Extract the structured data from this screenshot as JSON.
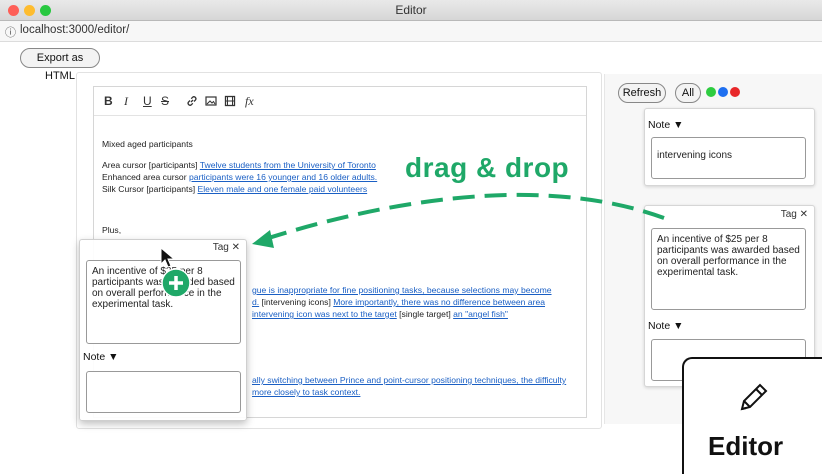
{
  "window": {
    "title": "Editor"
  },
  "address_bar": {
    "info_icon": "info-icon",
    "url": "localhost:3000/editor/"
  },
  "top_toolbar": {
    "export_label": "Export as HTML"
  },
  "editor": {
    "toolbar": {
      "bold": "B",
      "italic": "I",
      "underline": "U",
      "strike": "S",
      "icons": [
        "link-icon",
        "image-icon",
        "video-icon",
        "formula-icon"
      ],
      "formula": "fx"
    },
    "lines": {
      "l1": "Mixed aged participants",
      "l2_prefix": "Area cursor [participants]",
      "l2_link": "Twelve students from the University of Toronto",
      "l3_prefix": "Enhanced area cursor",
      "l3_link": "participants were 16 younger and 16 older adults.",
      "l4_prefix": "Silk Cursor [participants]",
      "l4_link": "Eleven male and one female paid volunteers",
      "l5": "Plus,",
      "l6_link": "gue is inappropriate for fine positioning tasks, because selections may become",
      "l7_link_a": "d.",
      "l7_mid": "[intervening icons]",
      "l7_link_b": "More importantly, there was no difference between area",
      "l8_link_a": "intervening icon was next to the target",
      "l8_mid": "[single target]",
      "l8_link_b": "an \"angel fish\"",
      "l9_link": "ally switching between Prince and point-cursor positioning techniques, the difficulty",
      "l10_link": "more closely to task context."
    }
  },
  "side_panel": {
    "refresh_label": "Refresh",
    "all_label": "All",
    "filter_colors": [
      "#2ecc40",
      "#1e6ff0",
      "#e8282a"
    ],
    "card1": {
      "note_label": "Note ▼",
      "note_text": "intervening icons"
    },
    "card2": {
      "tag_label": "Tag ✕",
      "text": "An incentive of $25 per 8 participants was awarded based on overall performance in the experimental task.",
      "note_label": "Note ▼"
    }
  },
  "dragged_card": {
    "tag_label": "Tag ✕",
    "text": "An incentive of $25 per 8 participants was awarded based on overall performance in the experimental task.",
    "note_label": "Note ▼"
  },
  "annotation": {
    "drag_text": "drag & drop",
    "color": "#1fa868"
  },
  "badge": {
    "label": "Editor",
    "icon": "pencil-icon"
  }
}
